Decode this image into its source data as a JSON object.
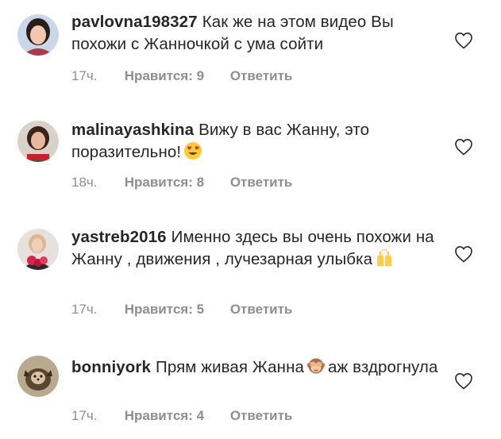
{
  "comments": [
    {
      "username": "pavlovna198327",
      "text": "Как же на этом видео Вы похожи с Жанночкой с ума сойти",
      "time": "17ч.",
      "likes": "Нравится: 9",
      "reply": "Ответить",
      "emoji": "",
      "text_after": ""
    },
    {
      "username": "malinayashkina",
      "text": "Вижу в вас Жанну, это поразительно!",
      "time": "18ч.",
      "likes": "Нравится: 8",
      "reply": "Ответить",
      "emoji": "heart-eyes-emoji",
      "text_after": ""
    },
    {
      "username": "yastreb2016",
      "text": "Именно здесь вы очень похожи на Жанну , движения , лучезарная улыбка",
      "time": "17ч.",
      "likes": "Нравится: 5",
      "reply": "Ответить",
      "emoji": "raising-hands-emoji",
      "text_after": ""
    },
    {
      "username": "bonniyork",
      "text": "Прям живая Жанна",
      "time": "17ч.",
      "likes": "Нравится: 4",
      "reply": "Ответить",
      "emoji": "see-no-evil-monkey-emoji",
      "text_after": "аж вздрогнула"
    }
  ]
}
